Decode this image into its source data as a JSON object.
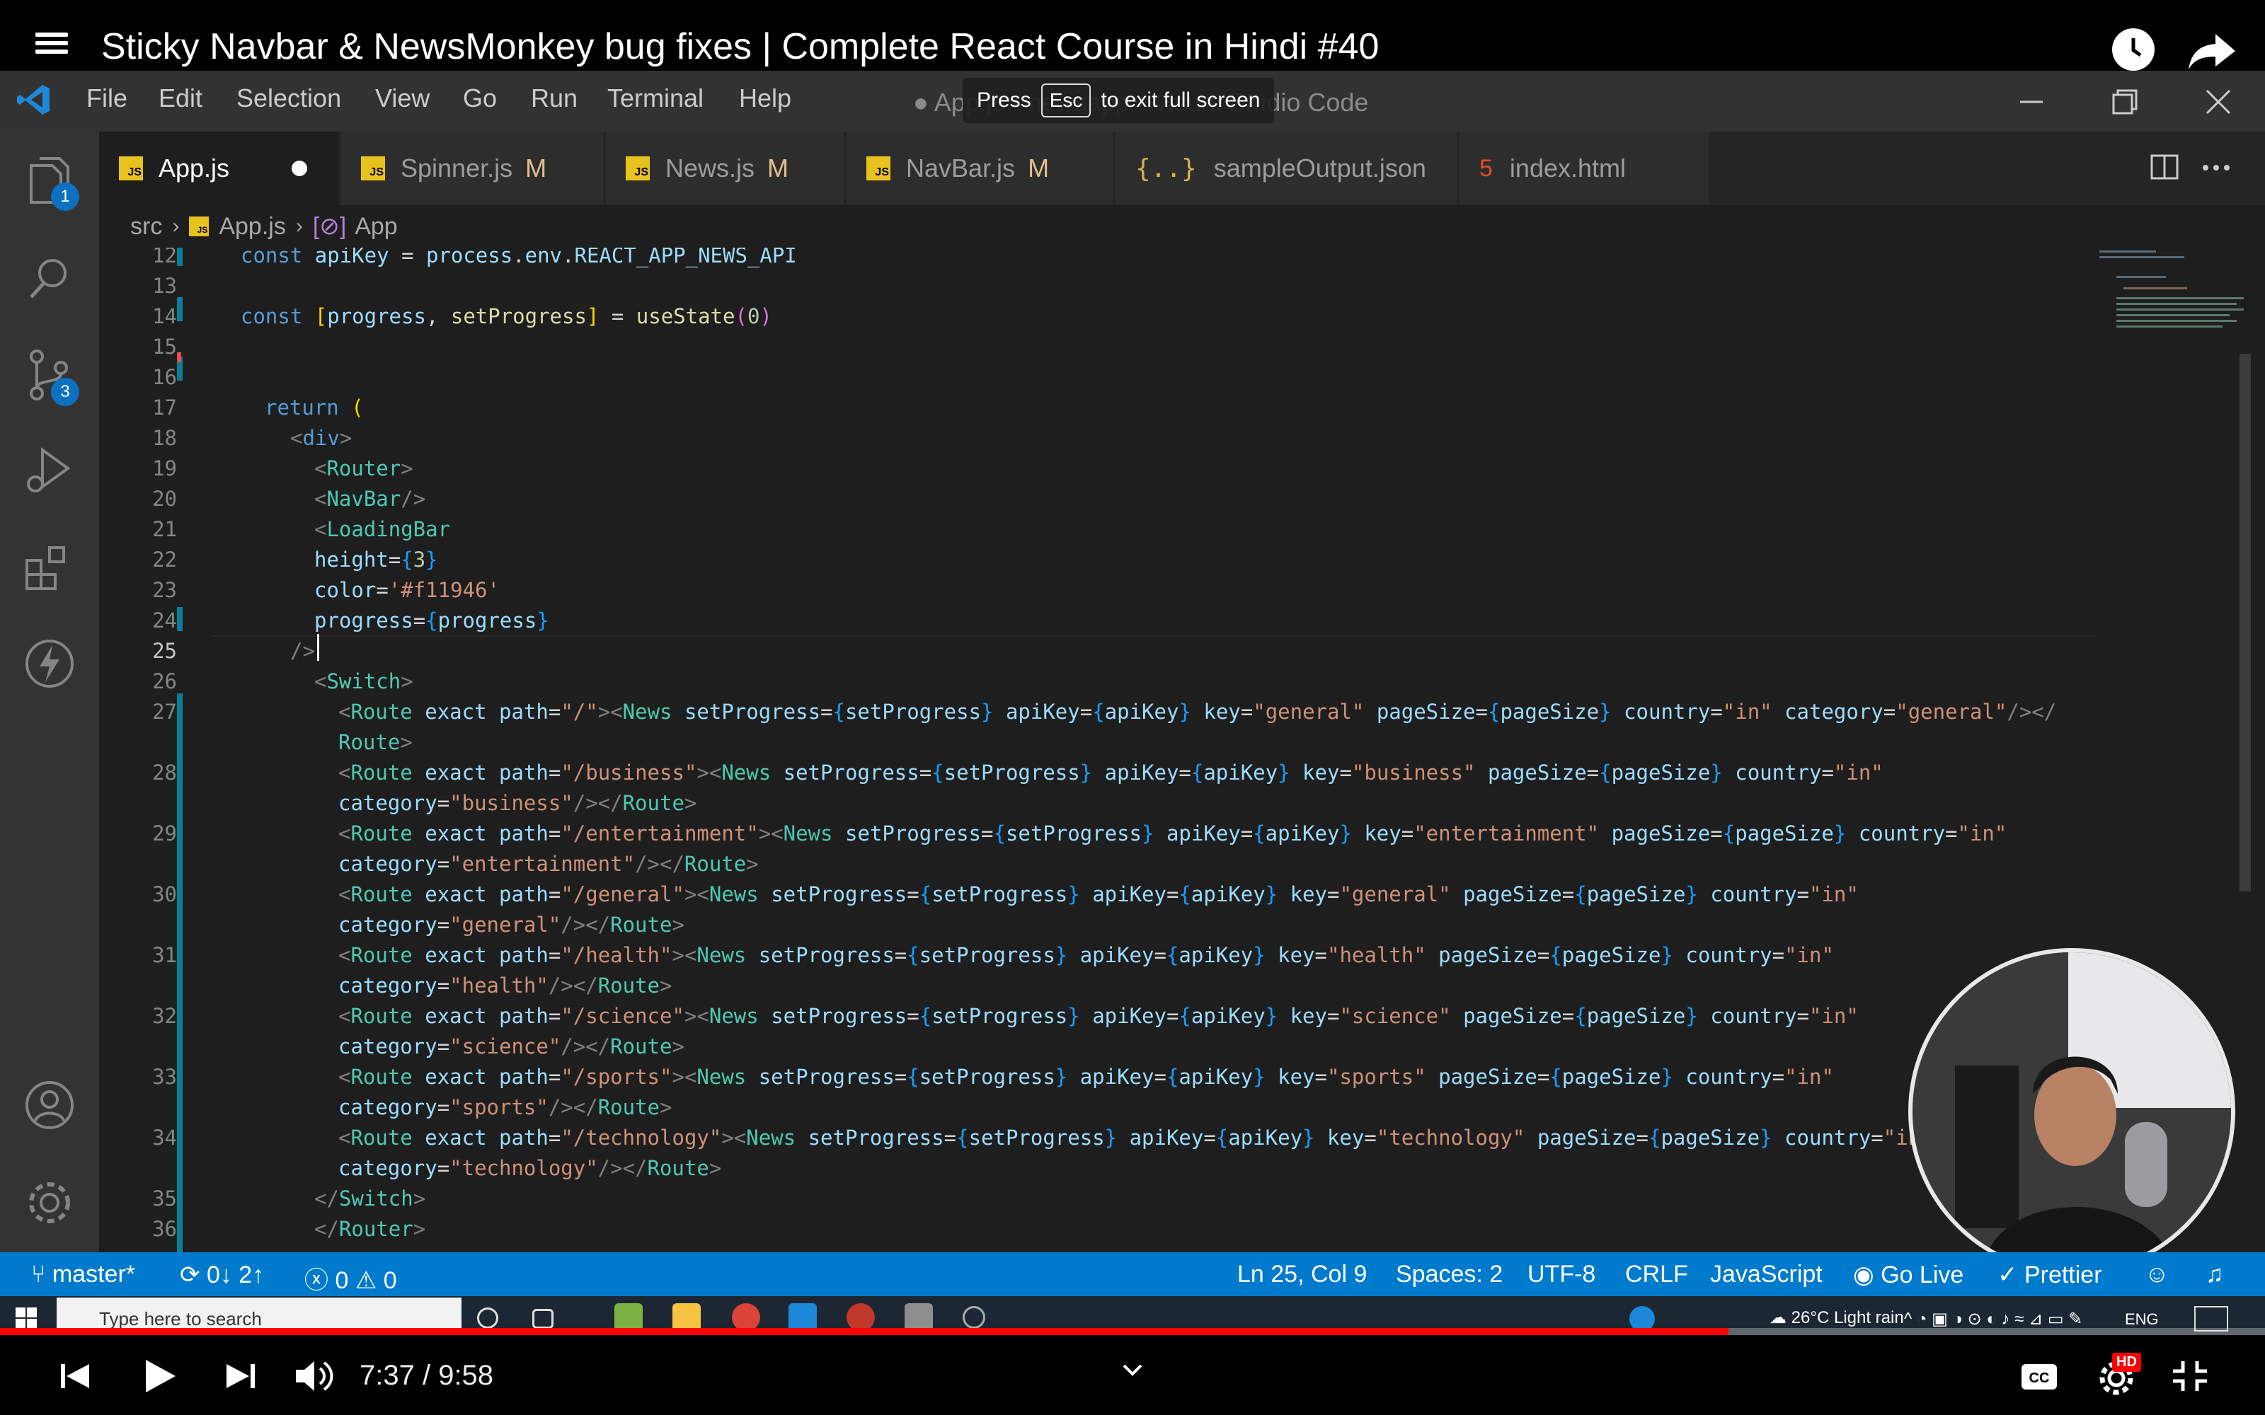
{
  "youtube": {
    "title": "Sticky Navbar & NewsMonkey bug fixes | Complete React Course in Hindi #40",
    "time_current": "7:37",
    "time_total": "9:58",
    "time_display": "7:37 / 9:58",
    "progress_fraction": 0.763,
    "hd_label": "HD"
  },
  "fullscreen_hint": {
    "prefix": "Press",
    "key": "Esc",
    "suffix": "to exit full screen"
  },
  "vscode": {
    "menu": [
      "File",
      "Edit",
      "Selection",
      "View",
      "Go",
      "Run",
      "Terminal",
      "Help"
    ],
    "window_title": "● App.js - newsapp - Visual Studio Code",
    "activity_badges": {
      "explorer": "1",
      "source_control": "3"
    },
    "tabs": [
      {
        "label": "App.js",
        "icon": "js-icon",
        "modified": "",
        "active": true,
        "dirty": true
      },
      {
        "label": "Spinner.js",
        "icon": "js-icon",
        "modified": "M",
        "active": false
      },
      {
        "label": "News.js",
        "icon": "js-icon",
        "modified": "M",
        "active": false
      },
      {
        "label": "NavBar.js",
        "icon": "js-icon",
        "modified": "M",
        "active": false
      },
      {
        "label": "sampleOutput.json",
        "icon": "json-icon",
        "modified": "",
        "active": false
      },
      {
        "label": "index.html",
        "icon": "html-icon",
        "modified": "",
        "active": false
      }
    ],
    "breadcrumb": [
      "src",
      "App.js",
      "App"
    ],
    "line_numbers": [
      "12",
      "13",
      "14",
      "15",
      "16",
      "17",
      "18",
      "19",
      "20",
      "21",
      "22",
      "23",
      "24",
      "25",
      "26",
      "27",
      "",
      "28",
      "",
      "29",
      "",
      "30",
      "",
      "31",
      "",
      "32",
      "",
      "33",
      "",
      "34",
      "",
      "35",
      "36"
    ],
    "status": {
      "branch": "master*",
      "sync": "0↓ 2↑",
      "errors": "0",
      "warnings": "0",
      "cursor": "Ln 25, Col 9",
      "spaces": "Spaces: 2",
      "encoding": "UTF-8",
      "eol": "CRLF",
      "language": "JavaScript",
      "golive": "Go Live",
      "prettier": "Prettier"
    }
  },
  "taskbar": {
    "search_placeholder": "Type here to search",
    "weather": "26°C  Light rain",
    "lang": "ENG"
  },
  "colors": {
    "accent": "#007acc",
    "youtube_red": "#ff0000",
    "editor_bg": "#1e1e1e"
  }
}
